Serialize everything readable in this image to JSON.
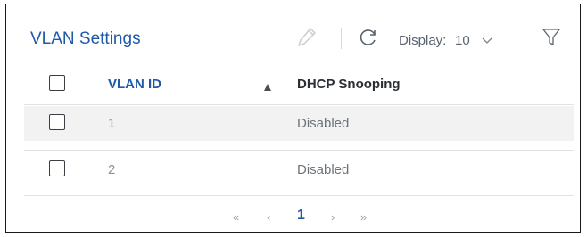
{
  "title": "VLAN Settings",
  "toolbar": {
    "edit_icon": "pencil-icon",
    "refresh_icon": "refresh-icon",
    "display_label": "Display:",
    "display_value": "10",
    "filter_icon": "filter-icon"
  },
  "table": {
    "columns": [
      "VLAN ID",
      "DHCP Snooping"
    ],
    "sort": "ascending",
    "rows": [
      {
        "vlan_id": "1",
        "dhcp_snooping": "Disabled"
      },
      {
        "vlan_id": "2",
        "dhcp_snooping": "Disabled"
      }
    ]
  },
  "pagination": {
    "first": "«",
    "prev": "‹",
    "current": "1",
    "next": "›",
    "last": "»"
  },
  "colors": {
    "accent": "#1f5aa8",
    "row_highlight": "#f2f2f2"
  }
}
